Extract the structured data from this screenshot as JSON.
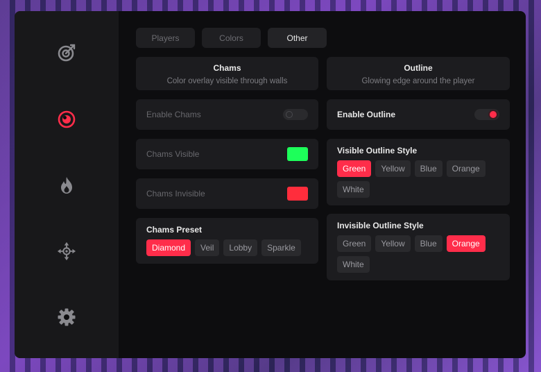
{
  "tabs": [
    {
      "label": "Players",
      "active": false
    },
    {
      "label": "Colors",
      "active": false
    },
    {
      "label": "Other",
      "active": true
    }
  ],
  "sidebar": {
    "icons": [
      "aim-target-icon",
      "eye-icon",
      "fire-icon",
      "crosshair-move-icon",
      "gear-icon"
    ],
    "active_index": 1,
    "accent": "#ff2d4a"
  },
  "chams_header": {
    "title": "Chams",
    "subtitle": "Color overlay visible through walls"
  },
  "outline_header": {
    "title": "Outline",
    "subtitle": "Glowing edge around the player"
  },
  "enable_chams": {
    "label": "Enable Chams",
    "enabled": false
  },
  "chams_visible": {
    "label": "Chams Visible",
    "color": "#1dff5a"
  },
  "chams_invisible": {
    "label": "Chams Invisible",
    "color": "#ff2d3c"
  },
  "chams_preset": {
    "label": "Chams Preset",
    "options": [
      "Diamond",
      "Veil",
      "Lobby",
      "Sparkle"
    ],
    "selected": "Diamond"
  },
  "enable_outline": {
    "label": "Enable Outline",
    "enabled": true
  },
  "visible_outline_style": {
    "label": "Visible Outline Style",
    "options": [
      "Green",
      "Yellow",
      "Blue",
      "Orange",
      "White"
    ],
    "selected": "Green"
  },
  "invisible_outline_style": {
    "label": "Invisible Outline Style",
    "options": [
      "Green",
      "Yellow",
      "Blue",
      "Orange",
      "White"
    ],
    "selected": "Orange"
  }
}
